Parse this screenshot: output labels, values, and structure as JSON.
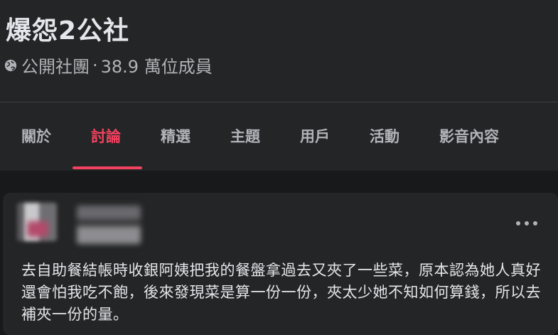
{
  "group": {
    "name": "爆怨2公社",
    "privacy_icon": "globe-icon",
    "privacy": "公開社團",
    "separator": "·",
    "members": "38.9 萬位成員"
  },
  "tabs": [
    {
      "label": "關於",
      "active": false
    },
    {
      "label": "討論",
      "active": true
    },
    {
      "label": "精選",
      "active": false
    },
    {
      "label": "主題",
      "active": false
    },
    {
      "label": "用戶",
      "active": false
    },
    {
      "label": "活動",
      "active": false
    },
    {
      "label": "影音內容",
      "active": false
    }
  ],
  "post": {
    "more_icon": "more-options-icon",
    "text": "去自助餐結帳時收銀阿姨把我的餐盤拿過去又夾了一些菜，原本認為她人真好還會怕我吃不飽，後來發現菜是算一份一份，夾太少她不知如何算錢，所以去補夾一份的量。"
  },
  "colors": {
    "accent": "#f3425f",
    "background": "#18191a",
    "surface": "#242526",
    "text_primary": "#e4e6eb",
    "text_secondary": "#b0b3b8"
  }
}
